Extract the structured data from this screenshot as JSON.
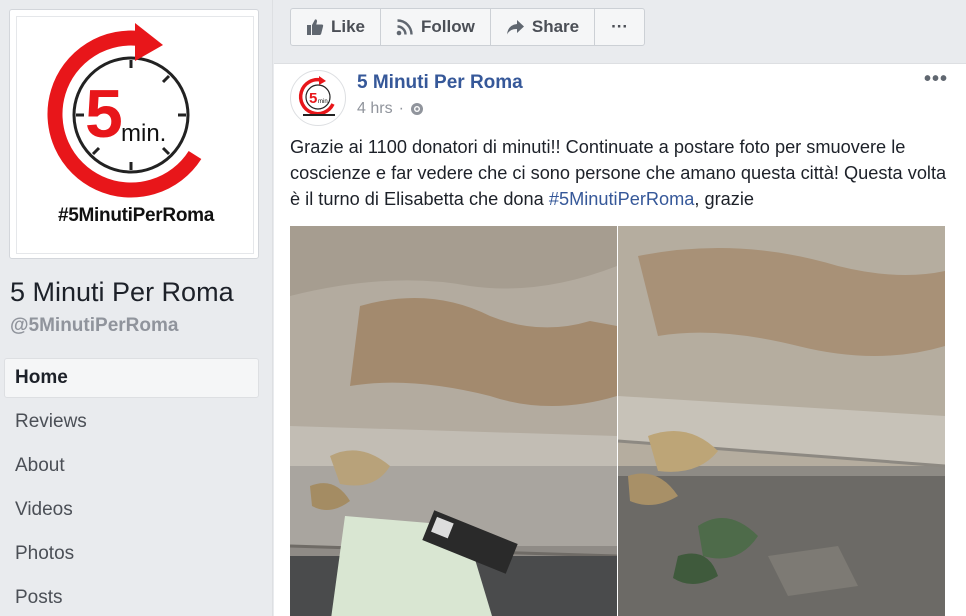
{
  "page": {
    "name": "5 Minuti Per Roma",
    "handle": "@5MinutiPerRoma"
  },
  "logo": {
    "number": "5",
    "unit": "min.",
    "hashtag": "#5MinutiPerRoma",
    "accent_color": "#e8161a"
  },
  "nav": {
    "items": [
      {
        "label": "Home",
        "active": true
      },
      {
        "label": "Reviews",
        "active": false
      },
      {
        "label": "About",
        "active": false
      },
      {
        "label": "Videos",
        "active": false
      },
      {
        "label": "Photos",
        "active": false
      },
      {
        "label": "Posts",
        "active": false
      }
    ]
  },
  "actions": {
    "like": "Like",
    "follow": "Follow",
    "share": "Share",
    "more": "···"
  },
  "post": {
    "author": "5 Minuti Per Roma",
    "time": "4 hrs",
    "separator": "·",
    "menu": "•••",
    "text_before": "Grazie ai 1100 donatori di minuti!! Continuate a postare foto per smuovere le coscienze e far vedere che ci sono persone che amano questa città! Questa volta è il turno di Elisabetta che dona ",
    "hashtag": "#5MinutiPerRoma",
    "text_after": ", grazie",
    "avatar_number": "5",
    "avatar_unit": "min."
  },
  "colors": {
    "link": "#365899",
    "muted": "#90949c",
    "background": "#e9ebee"
  }
}
